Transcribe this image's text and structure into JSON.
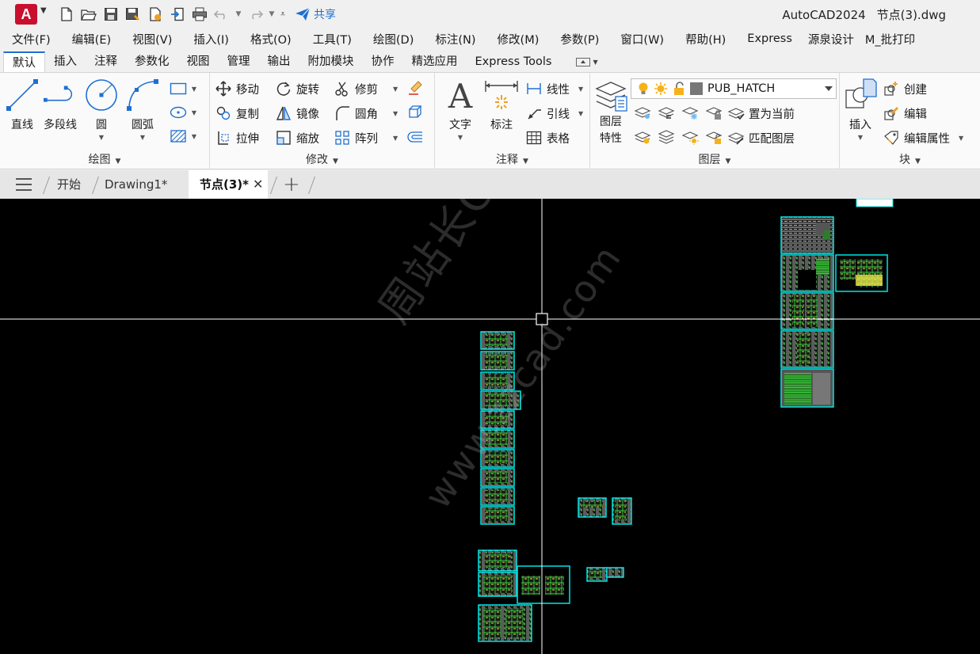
{
  "app": {
    "logo_letter": "A",
    "title": "AutoCAD2024",
    "document": "节点(3).dwg"
  },
  "quick_access": {
    "share_label": "共享",
    "icons": [
      "new-icon",
      "open-icon",
      "save-icon",
      "save-as-icon",
      "plot-icon",
      "import-icon",
      "print-icon",
      "undo-icon",
      "redo-icon"
    ]
  },
  "menubar": [
    "文件(F)",
    "编辑(E)",
    "视图(V)",
    "插入(I)",
    "格式(O)",
    "工具(T)",
    "绘图(D)",
    "标注(N)",
    "修改(M)",
    "参数(P)",
    "窗口(W)",
    "帮助(H)",
    "Express",
    "源泉设计",
    "M_批打印"
  ],
  "ribbon_tabs": [
    "默认",
    "插入",
    "注释",
    "参数化",
    "视图",
    "管理",
    "输出",
    "附加模块",
    "协作",
    "精选应用",
    "Express Tools"
  ],
  "ribbon": {
    "draw": {
      "title": "绘图",
      "line": "直线",
      "polyline": "多段线",
      "circle": "圆",
      "arc": "圆弧"
    },
    "modify": {
      "title": "修改",
      "move": "移动",
      "rotate": "旋转",
      "trim": "修剪",
      "copy": "复制",
      "mirror": "镜像",
      "fillet": "圆角",
      "stretch": "拉伸",
      "scale": "缩放",
      "array": "阵列"
    },
    "annotation": {
      "title": "注释",
      "text": "文字",
      "dimension": "标注",
      "linear": "线性",
      "leader": "引线",
      "table": "表格"
    },
    "layers": {
      "title": "图层",
      "properties_line1": "图层",
      "properties_line2": "特性",
      "current_layer": "PUB_HATCH",
      "set_current": "置为当前",
      "match_layer": "匹配图层"
    },
    "block": {
      "title": "块",
      "insert": "插入",
      "create": "创建",
      "edit": "编辑",
      "edit_attributes": "编辑属性"
    }
  },
  "file_tabs": {
    "items": [
      "开始",
      "Drawing1*",
      "节点(3)*"
    ],
    "active": "节点(3)*"
  },
  "colors": {
    "accent": "#1f6fd1",
    "logo": "#c8102e",
    "canvas": "#000000",
    "frame": "#00e5e5",
    "drawing_green": "#39d13a",
    "drawing_yellow": "#e8e84a"
  },
  "watermark": {
    "line1": "周站长CAD",
    "line2": "www.zzcad.com"
  }
}
